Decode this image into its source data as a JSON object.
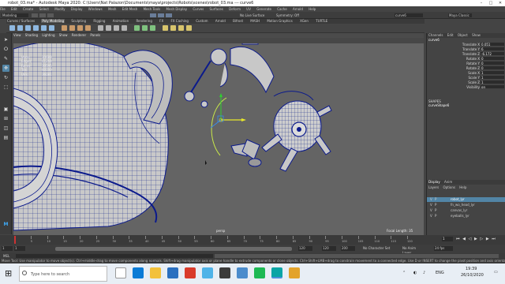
{
  "window": {
    "title": "robot_03.ma* - Autodesk Maya 2020: C:\\Users\\Nat Palazon\\Documents\\maya\\projects\\Robots\\scenes\\robot_03.ma --- curve6",
    "controls": [
      "–",
      "□",
      "✕"
    ]
  },
  "menubar": [
    "File",
    "Edit",
    "Create",
    "Select",
    "Modify",
    "Display",
    "Windows",
    "Mesh",
    "Edit Mesh",
    "Mesh Tools",
    "Mesh Display",
    "Curves",
    "Surfaces",
    "Deform",
    "UV",
    "Generate",
    "Cache",
    "Arnold",
    "Help"
  ],
  "status_line": {
    "menuset": "Modeling",
    "no_live_surface": "No Live Surface",
    "symmetry": "Symmetry: Off",
    "field": "curve6",
    "workspace": "Maya Classic"
  },
  "shelf_tabs": [
    "Curves / Surfaces",
    "Poly Modeling",
    "Sculpting",
    "Rigging",
    "Animation",
    "Rendering",
    "FX",
    "FX Caching",
    "Custom",
    "Arnold",
    "Bifrost",
    "MASH",
    "Motion Graphics",
    "XGen",
    "TURTLE"
  ],
  "shelf_active": "Poly Modeling",
  "panel_menu": [
    "View",
    "Shading",
    "Lighting",
    "Show",
    "Renderer",
    "Panels"
  ],
  "hud": [
    {
      "k": "Verts:",
      "v": "30688"
    },
    {
      "k": "Edges:",
      "v": "61268"
    },
    {
      "k": "Faces:",
      "v": "30595"
    },
    {
      "k": "Tris:",
      "v": "60700"
    },
    {
      "k": "UVs:",
      "v": "36081"
    }
  ],
  "viewport_labels": {
    "camera": "persp",
    "focal": "Focal Length:",
    "focal_value": "35"
  },
  "channel_box": {
    "tabs": [
      "Channels",
      "Edit",
      "Object",
      "Show"
    ],
    "object": "curve6",
    "attrs": [
      {
        "l": "Translate X",
        "v": "0.051"
      },
      {
        "l": "Translate Y",
        "v": "6"
      },
      {
        "l": "Translate Z",
        "v": "-6.172"
      },
      {
        "l": "Rotate X",
        "v": "0"
      },
      {
        "l": "Rotate Y",
        "v": "0"
      },
      {
        "l": "Rotate Z",
        "v": "0"
      },
      {
        "l": "Scale X",
        "v": "1"
      },
      {
        "l": "Scale Y",
        "v": "1"
      },
      {
        "l": "Scale Z",
        "v": "1"
      },
      {
        "l": "Visibility",
        "v": "on"
      }
    ],
    "shapes_title": "SHAPES",
    "shape_name": "curveShape6",
    "layer_tabs": [
      "Display",
      "Anim"
    ],
    "layer_menu": [
      "Layers",
      "Options",
      "Help"
    ],
    "layers": [
      "robot_lyr",
      "fn_wo_head_lyr",
      "canvas_lyr",
      "eyeballs_lyr"
    ]
  },
  "timeline": {
    "ticks": [
      "1",
      "5",
      "10",
      "15",
      "20",
      "25",
      "30",
      "35",
      "40",
      "45",
      "50",
      "55",
      "60",
      "65",
      "70",
      "75",
      "80",
      "85",
      "90",
      "95",
      "100",
      "105",
      "110",
      "115",
      "120"
    ],
    "current": "1"
  },
  "range": {
    "start": "1",
    "start2": "1",
    "end": "120",
    "end2": "120",
    "end3": "200",
    "fps": "24 fps",
    "character": "No Character Set",
    "anim_layer": "No Anim Layer"
  },
  "command_line": {
    "label": "MEL"
  },
  "help_line": "Move Tool: Use manipulator to move object(s). Ctrl+middle-drag to move components along normals. Shift+drag manipulator axis or plane handle to extrude components or clone objects. Ctrl+Shift+LMB+drag to constrain movement to a connected edge. Use D or INSERT to change the pivot position and axis orientation.",
  "taskbar": {
    "search_placeholder": "Type here to search",
    "time": "19:39",
    "date": "26/10/2020",
    "lang": "ENG"
  },
  "colors": {
    "viewport": "#646464",
    "wire": "#0b1a8c",
    "accent": "#4a90d9"
  }
}
